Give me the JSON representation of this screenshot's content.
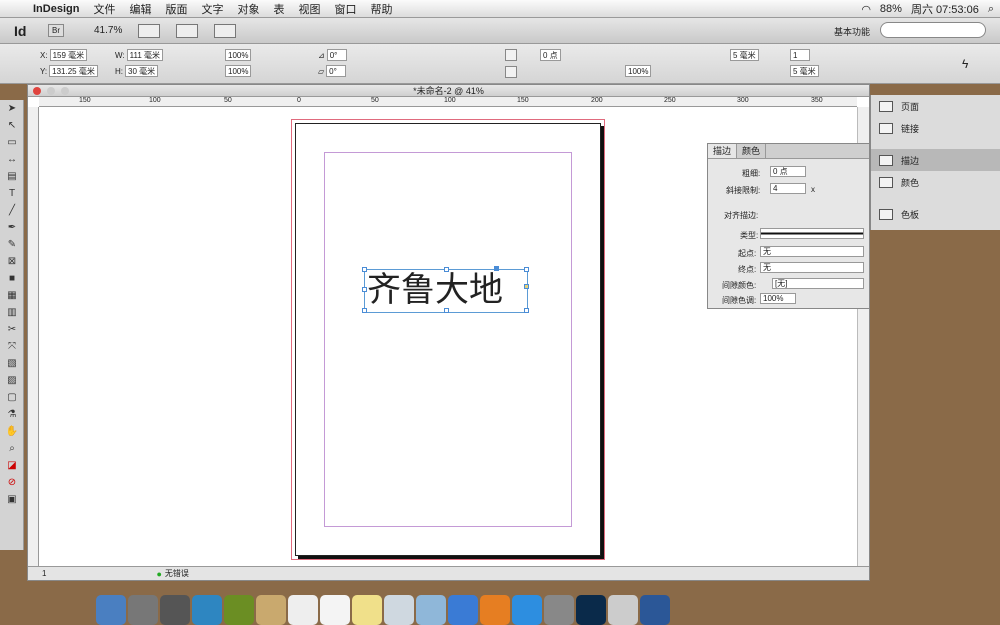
{
  "menubar": {
    "app": "InDesign",
    "items": [
      "文件",
      "编辑",
      "版面",
      "文字",
      "对象",
      "表",
      "视图",
      "窗口",
      "帮助"
    ],
    "battery": "88%",
    "clock": "周六 07:53:06"
  },
  "appbar": {
    "logo": "Id",
    "bridge": "Br",
    "zoom": "41.7%",
    "workspace": "基本功能"
  },
  "control": {
    "x": "159 毫米",
    "y": "131.25 毫米",
    "w": "111 毫米",
    "h": "30 毫米",
    "scale_x": "100%",
    "scale_y": "100%",
    "rotate": "0°",
    "shear": "0°",
    "stroke_weight": "0 点",
    "opacity": "100%",
    "col": "5 毫米",
    "col2": "5 毫米",
    "num": "1"
  },
  "document": {
    "title": "*未命名-2 @ 41%",
    "text": "齐鲁大地",
    "ruler_ticks": [
      "150",
      "100",
      "50",
      "0",
      "50",
      "100",
      "150",
      "200",
      "250",
      "300",
      "350"
    ],
    "page_num": "1",
    "errors": "无错误"
  },
  "stroke_panel": {
    "tabs": [
      "描边",
      "颜色"
    ],
    "weight_label": "粗细:",
    "weight": "0 点",
    "miter_label": "斜接限制:",
    "miter": "4",
    "miter_unit": "x",
    "align_label": "对齐描边:",
    "type_label": "类型:",
    "start_label": "起点:",
    "start_val": "无",
    "end_label": "终点:",
    "end_val": "无",
    "gap_color_label": "间隙颜色:",
    "gap_color": "[无]",
    "gap_tint_label": "间隙色调:",
    "gap_tint": "100%"
  },
  "dock_panel": {
    "items": [
      "页面",
      "链接",
      "描边",
      "颜色",
      "色板"
    ]
  }
}
